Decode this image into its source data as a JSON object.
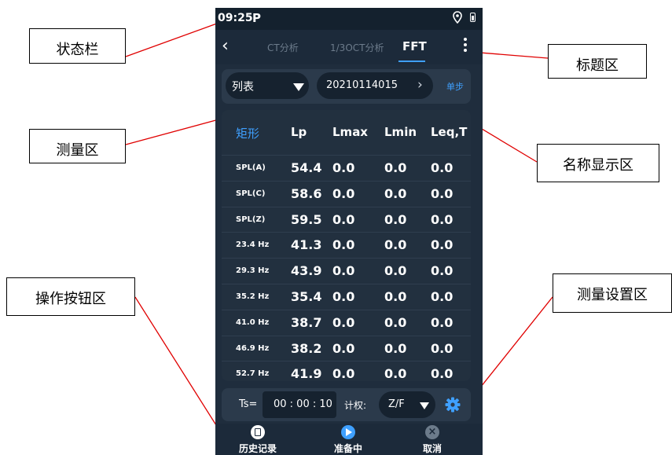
{
  "status_bar": {
    "time": "09:25",
    "app_icon": "P",
    "icons": [
      "location-icon",
      "battery-icon"
    ]
  },
  "title_bar": {
    "tabs": [
      "CT分析",
      "1/3OCT分析",
      "FFT"
    ],
    "active_tab": "FFT"
  },
  "name_bar": {
    "view_mode": "列表",
    "record_name": "20210114015",
    "step_label": "单步"
  },
  "table": {
    "headers": [
      "矩形",
      "Lp",
      "Lmax",
      "Lmin",
      "Leq,T"
    ],
    "rows": [
      {
        "label": "SPL(A)",
        "lp": "54.4",
        "lmax": "0.0",
        "lmin": "0.0",
        "leq": "0.0"
      },
      {
        "label": "SPL(C)",
        "lp": "58.6",
        "lmax": "0.0",
        "lmin": "0.0",
        "leq": "0.0"
      },
      {
        "label": "SPL(Z)",
        "lp": "59.5",
        "lmax": "0.0",
        "lmin": "0.0",
        "leq": "0.0"
      },
      {
        "label": "23.4 Hz",
        "lp": "41.3",
        "lmax": "0.0",
        "lmin": "0.0",
        "leq": "0.0"
      },
      {
        "label": "29.3 Hz",
        "lp": "43.9",
        "lmax": "0.0",
        "lmin": "0.0",
        "leq": "0.0"
      },
      {
        "label": "35.2 Hz",
        "lp": "35.4",
        "lmax": "0.0",
        "lmin": "0.0",
        "leq": "0.0"
      },
      {
        "label": "41.0 Hz",
        "lp": "38.7",
        "lmax": "0.0",
        "lmin": "0.0",
        "leq": "0.0"
      },
      {
        "label": "46.9 Hz",
        "lp": "38.2",
        "lmax": "0.0",
        "lmin": "0.0",
        "leq": "0.0"
      },
      {
        "label": "52.7 Hz",
        "lp": "41.9",
        "lmax": "0.0",
        "lmin": "0.0",
        "leq": "0.0"
      }
    ]
  },
  "settings": {
    "ts_label": "Ts=",
    "ts_value": "00 : 00 : 10",
    "weighting_label": "计权:",
    "weighting_value": "Z/F"
  },
  "buttons": {
    "history": "历史记录",
    "ready": "准备中",
    "cancel": "取消"
  },
  "callouts": {
    "status_bar": "状态栏",
    "title_area": "标题区",
    "measure_area": "测量区",
    "name_area": "名称显示区",
    "button_area": "操作按钮区",
    "settings_area": "测量设置区"
  },
  "colors": {
    "accent": "#3fa0ff",
    "background": "#1f2d3d",
    "annotation_line": "#e00000"
  }
}
